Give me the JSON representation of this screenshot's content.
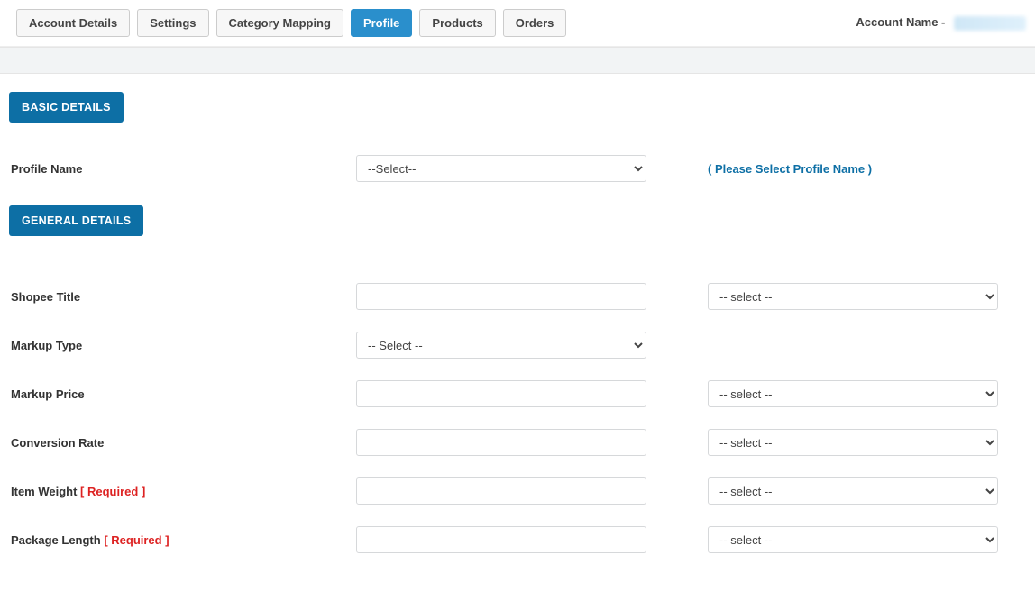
{
  "tabs": {
    "account_details": "Account Details",
    "settings": "Settings",
    "category_mapping": "Category Mapping",
    "profile": "Profile",
    "products": "Products",
    "orders": "Orders"
  },
  "account": {
    "label": "Account Name -"
  },
  "sections": {
    "basic": "BASIC DETAILS",
    "general": "GENERAL DETAILS"
  },
  "basic": {
    "profile_name_label": "Profile Name",
    "profile_name_option": "--Select--",
    "profile_name_hint": "( Please Select Profile Name )"
  },
  "general": {
    "shopee_title_label": "Shopee Title",
    "markup_type_label": "Markup Type",
    "markup_type_option": "-- Select --",
    "markup_price_label": "Markup Price",
    "conversion_rate_label": "Conversion Rate",
    "item_weight_label": "Item Weight ",
    "item_weight_req": "[ Required ]",
    "package_length_label": "Package Length ",
    "package_length_req": "[ Required ]",
    "select_option": "-- select --"
  }
}
